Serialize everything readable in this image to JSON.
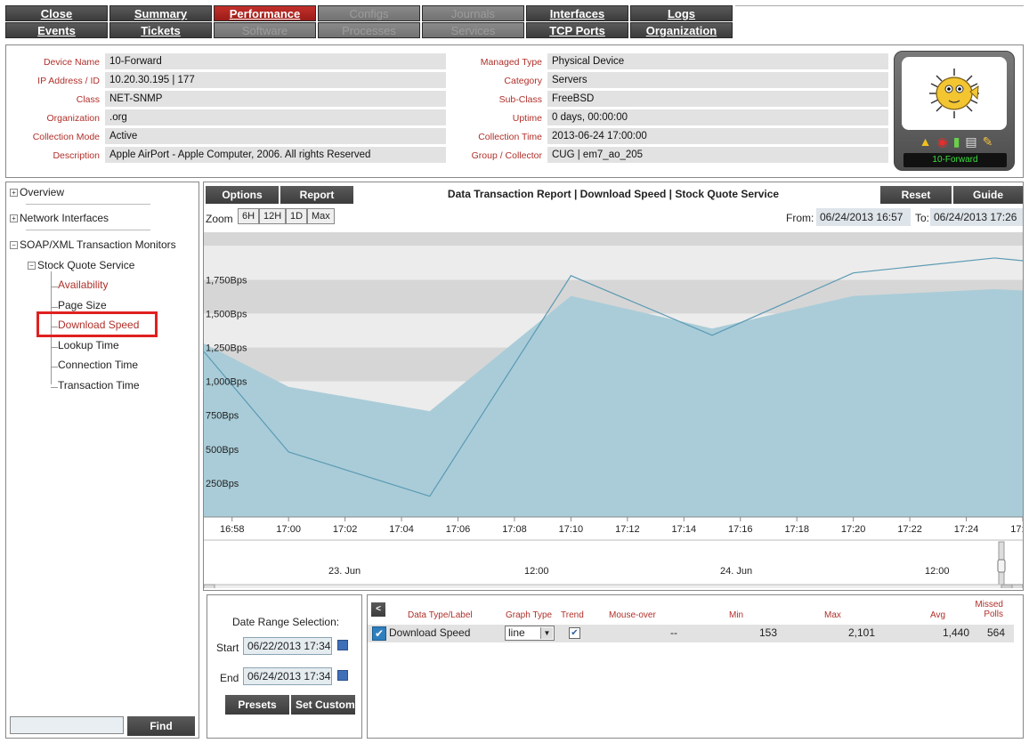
{
  "tabs": {
    "row1": [
      {
        "label": "Close",
        "state": "normal"
      },
      {
        "label": "Summary",
        "state": "normal"
      },
      {
        "label": "Performance",
        "state": "active"
      },
      {
        "label": "Configs",
        "state": "disabled"
      },
      {
        "label": "Journals",
        "state": "disabled"
      },
      {
        "label": "Interfaces",
        "state": "normal"
      },
      {
        "label": "Logs",
        "state": "normal"
      }
    ],
    "row2": [
      {
        "label": "Events",
        "state": "normal"
      },
      {
        "label": "Tickets",
        "state": "normal"
      },
      {
        "label": "Software",
        "state": "disabled"
      },
      {
        "label": "Processes",
        "state": "disabled"
      },
      {
        "label": "Services",
        "state": "disabled"
      },
      {
        "label": "TCP Ports",
        "state": "normal"
      },
      {
        "label": "Organization",
        "state": "normal"
      }
    ]
  },
  "device": {
    "left": [
      {
        "label": "Device Name",
        "value": "10-Forward"
      },
      {
        "label": "IP Address / ID",
        "value": "10.20.30.195 | 177"
      },
      {
        "label": "Class",
        "value": "NET-SNMP"
      },
      {
        "label": "Organization",
        "value": ".org"
      },
      {
        "label": "Collection Mode",
        "value": "Active"
      },
      {
        "label": "Description",
        "value": "Apple AirPort - Apple Computer, 2006. All rights Reserved"
      }
    ],
    "right": [
      {
        "label": "Managed Type",
        "value": "Physical Device"
      },
      {
        "label": "Category",
        "value": "Servers"
      },
      {
        "label": "Sub-Class",
        "value": "FreeBSD"
      },
      {
        "label": "Uptime",
        "value": "0 days, 00:00:00"
      },
      {
        "label": "Collection Time",
        "value": "2013-06-24 17:00:00"
      },
      {
        "label": "Group / Collector",
        "value": "CUG | em7_ao_205"
      }
    ],
    "badge_name": "10-Forward",
    "badge_icons": [
      "warning-icon",
      "lifebuoy-icon",
      "bar-chart-icon",
      "printer-icon",
      "wrench-icon"
    ]
  },
  "tree": {
    "overview": "Overview",
    "network_interfaces": "Network Interfaces",
    "soap_monitors": "SOAP/XML Transaction Monitors",
    "service": "Stock Quote Service",
    "items": [
      {
        "label": "Availability",
        "color": "red"
      },
      {
        "label": "Page Size",
        "color": "black"
      },
      {
        "label": "Download Speed",
        "color": "red"
      },
      {
        "label": "Lookup Time",
        "color": "black"
      },
      {
        "label": "Connection Time",
        "color": "black"
      },
      {
        "label": "Transaction Time",
        "color": "black"
      }
    ],
    "find_label": "Find"
  },
  "graph": {
    "options_label": "Options",
    "report_label": "Report",
    "title": "Data Transaction Report | Download Speed | Stock Quote Service",
    "reset_label": "Reset",
    "guide_label": "Guide",
    "zoom_label": "Zoom",
    "zoom_options": [
      "6H",
      "12H",
      "1D",
      "Max"
    ],
    "from_label": "From:",
    "from_value": "06/24/2013 16:57",
    "to_label": "To:",
    "to_value": "06/24/2013 17:26",
    "navigator_labels": [
      "23. Jun",
      "12:00",
      "24. Jun",
      "12:00"
    ]
  },
  "chart_data": {
    "type": "line",
    "title": "Data Transaction Report | Download Speed | Stock Quote Service",
    "x_ticks": [
      "16:58",
      "17:00",
      "17:02",
      "17:04",
      "17:06",
      "17:08",
      "17:10",
      "17:12",
      "17:14",
      "17:16",
      "17:18",
      "17:20",
      "17:22",
      "17:24",
      "17:26"
    ],
    "y_ticks": [
      "250Bps",
      "500Bps",
      "750Bps",
      "1,000Bps",
      "1,250Bps",
      "1,500Bps",
      "1,750Bps"
    ],
    "ylim": [
      0,
      2100
    ],
    "series": [
      {
        "name": "Download Speed",
        "values": [
          {
            "x": "16:57",
            "y": 1220
          },
          {
            "x": "17:00",
            "y": 480
          },
          {
            "x": "17:05",
            "y": 153
          },
          {
            "x": "17:10",
            "y": 1780
          },
          {
            "x": "17:15",
            "y": 1340
          },
          {
            "x": "17:20",
            "y": 1800
          },
          {
            "x": "17:25",
            "y": 1910
          },
          {
            "x": "17:26",
            "y": 1890
          }
        ]
      }
    ],
    "area_range": {
      "high": [
        {
          "x": "16:57",
          "y": 1280
        },
        {
          "x": "17:00",
          "y": 960
        },
        {
          "x": "17:05",
          "y": 780
        },
        {
          "x": "17:10",
          "y": 1630
        },
        {
          "x": "17:15",
          "y": 1390
        },
        {
          "x": "17:20",
          "y": 1630
        },
        {
          "x": "17:25",
          "y": 1680
        },
        {
          "x": "17:26",
          "y": 1670
        }
      ]
    },
    "colors": {
      "line": "#5b9ab3",
      "area": "#a9ccd8",
      "band_dark": "#d6d6d6",
      "band_light": "#ececec"
    }
  },
  "date_range": {
    "title": "Date Range Selection:",
    "start_label": "Start",
    "start_value": "06/22/2013 17:34",
    "end_label": "End",
    "end_value": "06/24/2013 17:34",
    "presets_label": "Presets",
    "custom_label": "Set Custom"
  },
  "legend": {
    "headers": {
      "label": "Data Type/Label",
      "graph_type": "Graph Type",
      "trend": "Trend",
      "mouse_over": "Mouse-over",
      "min": "Min",
      "max": "Max",
      "avg": "Avg",
      "missed": "Missed Polls"
    },
    "row": {
      "label": "Download Speed",
      "graph_type": "line",
      "mouse_over": "--",
      "min": "153",
      "max": "2,101",
      "avg": "1,440",
      "missed": "564"
    }
  }
}
